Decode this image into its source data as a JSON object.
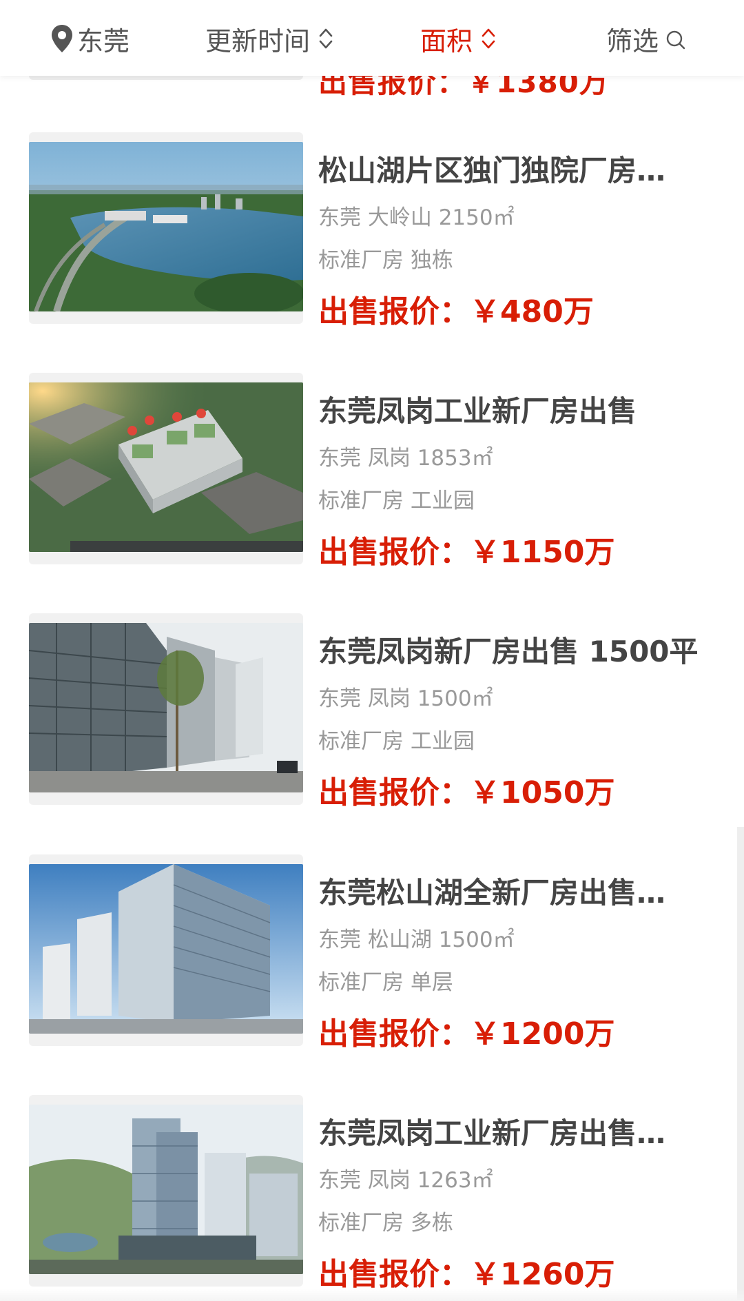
{
  "topbar": {
    "city": "东莞",
    "sort_time": "更新时间",
    "sort_area": "面积",
    "filter": "筛选"
  },
  "partial_card": {
    "price": "出售报价：￥1380万"
  },
  "listings": [
    {
      "title": "松山湖片区独门独院厂房…",
      "meta": "东莞 大岭山 2150㎡",
      "tags": "标准厂房 独栋",
      "price": "出售报价：￥480万",
      "image": "lake-aerial-photo"
    },
    {
      "title": "东莞凤岗工业新厂房出售",
      "meta": "东莞 凤岗 1853㎡",
      "tags": "标准厂房 工业园",
      "price": "出售报价：￥1150万",
      "image": "industrial-park-aerial-rendering"
    },
    {
      "title": "东莞凤岗新厂房出售 1500平",
      "meta": "东莞 凤岗 1500㎡",
      "tags": "标准厂房 工业园",
      "price": "出售报价：￥1050万",
      "image": "street-buildings-photo"
    },
    {
      "title": "东莞松山湖全新厂房出售…",
      "meta": "东莞 松山湖 1500㎡",
      "tags": "标准厂房 单层",
      "price": "出售报价：￥1200万",
      "image": "glass-tower-rendering"
    },
    {
      "title": "东莞凤岗工业新厂房出售…",
      "meta": "东莞 凤岗 1263㎡",
      "tags": "标准厂房 多栋",
      "price": "出售报价：￥1260万",
      "image": "hillside-towers-rendering"
    }
  ],
  "colors": {
    "accent": "#d81e06",
    "title": "#444444",
    "meta": "#999999"
  }
}
